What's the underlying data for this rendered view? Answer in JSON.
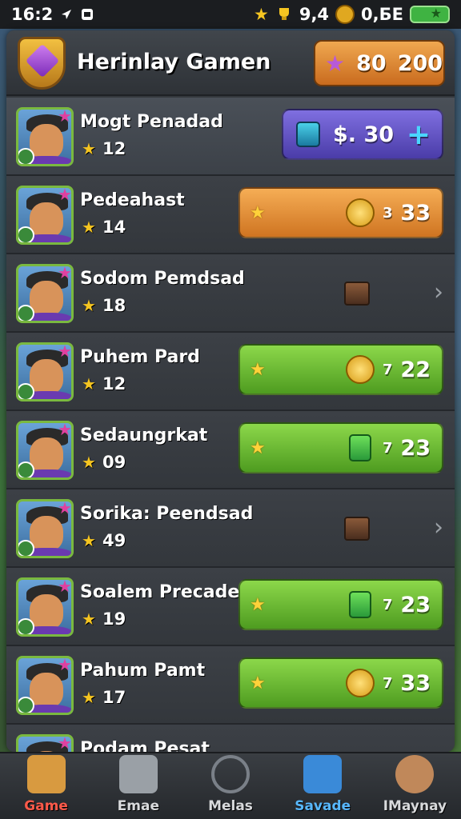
{
  "status": {
    "time": "16:2",
    "cups": "9,4",
    "coins": "0,БЕ"
  },
  "header": {
    "title": "Herinlay Gamen",
    "gems_a": "80",
    "gems_b": "200"
  },
  "rows": [
    {
      "name": "Mogt Penadad",
      "sub": "12",
      "action_type": "purple",
      "action_price": "$. 30"
    },
    {
      "name": "Pedeahast",
      "sub": "14",
      "action_type": "orange",
      "action_small": "3",
      "action_big": "33",
      "icon": "coin"
    },
    {
      "name": "Sodom Pemdsad",
      "sub": "18",
      "action_type": "chest"
    },
    {
      "name": "Puhem Pard",
      "sub": "12",
      "action_type": "green",
      "action_small": "7",
      "action_big": "22",
      "icon": "coin"
    },
    {
      "name": "Sedaungrkat",
      "sub": "09",
      "action_type": "green",
      "action_small": "7",
      "action_big": "23",
      "icon": "bottle"
    },
    {
      "name": "Sorika: Peendsad",
      "sub": "49",
      "action_type": "chest"
    },
    {
      "name": "Soalem Precade",
      "sub": "19",
      "action_type": "green",
      "action_small": "7",
      "action_big": "23",
      "icon": "bottle"
    },
    {
      "name": "Pahum Pamt",
      "sub": "17",
      "action_type": "green",
      "action_small": "7",
      "action_big": "33",
      "icon": "coin"
    },
    {
      "name": "Podam Pesat",
      "sub": "",
      "action_type": "none"
    }
  ],
  "nav": [
    {
      "label": "Game",
      "state": "active-red"
    },
    {
      "label": "Emae",
      "state": "muted"
    },
    {
      "label": "Melas",
      "state": "muted"
    },
    {
      "label": "Savade",
      "state": "active-blue"
    },
    {
      "label": "IMaynay",
      "state": "muted"
    }
  ],
  "colors": {
    "orange": "#e08a30",
    "green": "#6cbc34",
    "purple": "#6352c4",
    "nav_active": "#ff5a4a"
  }
}
